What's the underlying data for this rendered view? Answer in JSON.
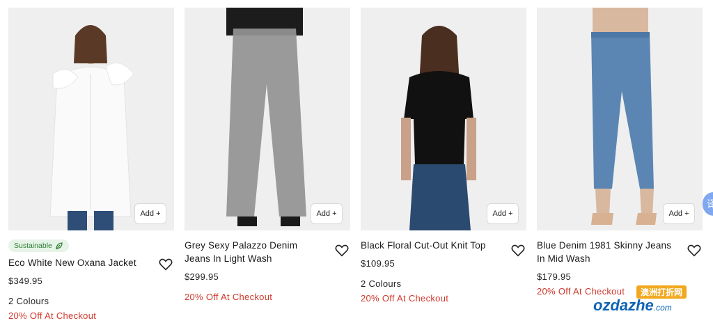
{
  "products": [
    {
      "badge": "Sustainable",
      "name": "Eco White New Oxana Jacket",
      "price": "$349.95",
      "colours": "2 Colours",
      "promo": "20% Off At Checkout",
      "add_label": "Add +"
    },
    {
      "name": "Grey Sexy Palazzo Denim Jeans In Light Wash",
      "price": "$299.95",
      "promo": "20% Off At Checkout",
      "add_label": "Add +"
    },
    {
      "name": "Black Floral Cut-Out Knit Top",
      "price": "$109.95",
      "colours": "2 Colours",
      "promo": "20% Off At Checkout",
      "add_label": "Add +"
    },
    {
      "name": "Blue Denim 1981 Skinny Jeans In Mid Wash",
      "price": "$179.95",
      "promo": "20% Off At Checkout",
      "add_label": "Add +"
    }
  ],
  "side_tab": {
    "label": "译"
  },
  "watermark": {
    "cn": "澳洲打折网",
    "en": "ozdazhe",
    "suffix": ".com"
  },
  "colors": {
    "promo": "#d0382b",
    "badge_bg": "#e6f4e8",
    "badge_text": "#2e7d32"
  },
  "icons": [
    "leaf-icon",
    "heart-icon"
  ]
}
